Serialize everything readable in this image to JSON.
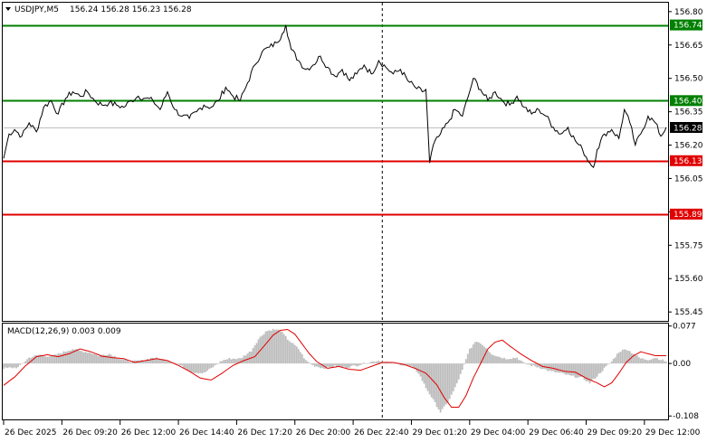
{
  "header": {
    "symbol": "USDJPY,M5",
    "ohlc": "156.24 156.28 156.23 156.28"
  },
  "chart_data": [
    {
      "type": "line",
      "title": "USDJPY,M5",
      "ylim": [
        155.41,
        156.84
      ],
      "y_ticks": [
        "156.80",
        "156.65",
        "156.50",
        "156.35",
        "156.20",
        "156.05",
        "155.90",
        "155.75",
        "155.60",
        "155.45"
      ],
      "y_tick_values": [
        156.8,
        156.65,
        156.5,
        156.35,
        156.2,
        156.05,
        155.9,
        155.75,
        155.6,
        155.45
      ],
      "x_labels": [
        "26 Dec 2025",
        "26 Dec 09:20",
        "26 Dec 12:00",
        "26 Dec 14:40",
        "26 Dec 17:20",
        "26 Dec 20:00",
        "26 Dec 22:40",
        "29 Dec 01:20",
        "29 Dec 04:00",
        "29 Dec 06:40",
        "29 Dec 09:20",
        "29 Dec 12:00"
      ],
      "x_label_index": [
        0,
        32,
        64,
        96,
        128,
        160,
        192,
        224,
        256,
        288,
        320,
        352
      ],
      "current_price": {
        "label": "156.28",
        "value": 156.28,
        "color": "#000000"
      },
      "levels": [
        {
          "label": "156.74",
          "value": 156.74,
          "color": "#008000"
        },
        {
          "label": "156.40",
          "value": 156.4,
          "color": "#008000"
        },
        {
          "label": "156.13",
          "value": 156.13,
          "color": "#e00000"
        },
        {
          "label": "155.89",
          "value": 155.89,
          "color": "#e00000"
        }
      ],
      "vline_index": 208,
      "series": [
        {
          "color": "#000000",
          "anchors": [
            [
              0,
              156.14
            ],
            [
              3,
              156.25
            ],
            [
              6,
              156.27
            ],
            [
              10,
              156.24
            ],
            [
              14,
              156.3
            ],
            [
              18,
              156.26
            ],
            [
              22,
              156.37
            ],
            [
              26,
              156.4
            ],
            [
              30,
              156.34
            ],
            [
              34,
              156.41
            ],
            [
              38,
              156.44
            ],
            [
              42,
              156.42
            ],
            [
              46,
              156.44
            ],
            [
              50,
              156.4
            ],
            [
              54,
              156.38
            ],
            [
              58,
              156.39
            ],
            [
              62,
              156.38
            ],
            [
              66,
              156.37
            ],
            [
              70,
              156.4
            ],
            [
              74,
              156.42
            ],
            [
              78,
              156.41
            ],
            [
              82,
              156.4
            ],
            [
              86,
              156.36
            ],
            [
              90,
              156.44
            ],
            [
              94,
              156.36
            ],
            [
              98,
              156.33
            ],
            [
              102,
              156.32
            ],
            [
              106,
              156.35
            ],
            [
              110,
              156.38
            ],
            [
              114,
              156.37
            ],
            [
              118,
              156.4
            ],
            [
              122,
              156.46
            ],
            [
              126,
              156.42
            ],
            [
              130,
              156.4
            ],
            [
              134,
              156.48
            ],
            [
              138,
              156.56
            ],
            [
              142,
              156.62
            ],
            [
              146,
              156.64
            ],
            [
              150,
              156.66
            ],
            [
              153,
              156.7
            ],
            [
              155,
              156.74
            ],
            [
              158,
              156.63
            ],
            [
              162,
              156.58
            ],
            [
              166,
              156.54
            ],
            [
              170,
              156.56
            ],
            [
              174,
              156.6
            ],
            [
              178,
              156.55
            ],
            [
              182,
              156.51
            ],
            [
              186,
              156.54
            ],
            [
              190,
              156.49
            ],
            [
              194,
              156.52
            ],
            [
              198,
              156.56
            ],
            [
              202,
              156.52
            ],
            [
              206,
              156.58
            ],
            [
              210,
              156.55
            ],
            [
              214,
              156.52
            ],
            [
              218,
              156.54
            ],
            [
              222,
              156.49
            ],
            [
              226,
              156.46
            ],
            [
              230,
              156.44
            ],
            [
              232,
              156.45
            ],
            [
              234,
              156.12
            ],
            [
              236,
              156.2
            ],
            [
              240,
              156.25
            ],
            [
              244,
              156.3
            ],
            [
              248,
              156.36
            ],
            [
              252,
              156.33
            ],
            [
              256,
              156.44
            ],
            [
              258,
              156.5
            ],
            [
              262,
              156.45
            ],
            [
              266,
              156.4
            ],
            [
              270,
              156.44
            ],
            [
              274,
              156.4
            ],
            [
              278,
              156.38
            ],
            [
              282,
              156.42
            ],
            [
              286,
              156.37
            ],
            [
              290,
              156.34
            ],
            [
              294,
              156.36
            ],
            [
              298,
              156.33
            ],
            [
              302,
              156.28
            ],
            [
              306,
              156.25
            ],
            [
              310,
              156.28
            ],
            [
              314,
              156.22
            ],
            [
              318,
              156.18
            ],
            [
              322,
              156.12
            ],
            [
              324,
              156.1
            ],
            [
              326,
              156.18
            ],
            [
              330,
              156.25
            ],
            [
              334,
              156.27
            ],
            [
              338,
              156.23
            ],
            [
              341,
              156.36
            ],
            [
              344,
              156.3
            ],
            [
              347,
              156.2
            ],
            [
              350,
              156.25
            ],
            [
              354,
              156.33
            ],
            [
              358,
              156.3
            ],
            [
              361,
              156.24
            ],
            [
              364,
              156.28
            ]
          ]
        }
      ]
    },
    {
      "type": "bar",
      "title": "MACD(12,26,9) 0.003 0.009",
      "ylim": [
        -0.115,
        0.082
      ],
      "y_ticks": [
        "0.077",
        "0.00",
        "-0.108"
      ],
      "y_tick_values": [
        0.077,
        0.0,
        -0.108
      ],
      "histogram_anchors": [
        [
          0,
          -0.01
        ],
        [
          8,
          -0.008
        ],
        [
          14,
          0.012
        ],
        [
          20,
          0.018
        ],
        [
          26,
          0.014
        ],
        [
          32,
          0.022
        ],
        [
          38,
          0.03
        ],
        [
          42,
          0.026
        ],
        [
          48,
          0.022
        ],
        [
          52,
          0.016
        ],
        [
          58,
          0.02
        ],
        [
          64,
          0.01
        ],
        [
          70,
          0.004
        ],
        [
          76,
          0.006
        ],
        [
          82,
          0.012
        ],
        [
          88,
          0.008
        ],
        [
          94,
          0.002
        ],
        [
          100,
          -0.01
        ],
        [
          104,
          -0.018
        ],
        [
          110,
          -0.02
        ],
        [
          114,
          -0.01
        ],
        [
          120,
          0.006
        ],
        [
          124,
          0.01
        ],
        [
          130,
          0.01
        ],
        [
          136,
          0.026
        ],
        [
          140,
          0.05
        ],
        [
          144,
          0.066
        ],
        [
          148,
          0.07
        ],
        [
          152,
          0.068
        ],
        [
          156,
          0.05
        ],
        [
          162,
          0.03
        ],
        [
          166,
          0.006
        ],
        [
          170,
          -0.004
        ],
        [
          176,
          -0.01
        ],
        [
          182,
          -0.006
        ],
        [
          188,
          -0.008
        ],
        [
          194,
          -0.004
        ],
        [
          200,
          0.002
        ],
        [
          206,
          0.006
        ],
        [
          212,
          0.002
        ],
        [
          218,
          -0.002
        ],
        [
          224,
          -0.006
        ],
        [
          228,
          -0.02
        ],
        [
          232,
          -0.05
        ],
        [
          236,
          -0.075
        ],
        [
          240,
          -0.1
        ],
        [
          244,
          -0.08
        ],
        [
          248,
          -0.05
        ],
        [
          252,
          -0.014
        ],
        [
          256,
          0.03
        ],
        [
          260,
          0.046
        ],
        [
          264,
          0.036
        ],
        [
          268,
          0.02
        ],
        [
          272,
          0.014
        ],
        [
          276,
          0.01
        ],
        [
          282,
          0.012
        ],
        [
          286,
          0.0
        ],
        [
          290,
          -0.004
        ],
        [
          296,
          -0.01
        ],
        [
          300,
          -0.016
        ],
        [
          306,
          -0.02
        ],
        [
          312,
          -0.026
        ],
        [
          318,
          -0.03
        ],
        [
          322,
          -0.04
        ],
        [
          326,
          -0.026
        ],
        [
          330,
          -0.01
        ],
        [
          334,
          0.004
        ],
        [
          338,
          0.024
        ],
        [
          342,
          0.03
        ],
        [
          346,
          0.02
        ],
        [
          350,
          0.01
        ],
        [
          354,
          0.008
        ],
        [
          358,
          0.012
        ],
        [
          364,
          0.004
        ]
      ],
      "signal": {
        "color": "#e00000",
        "anchors": [
          [
            0,
            -0.045
          ],
          [
            6,
            -0.028
          ],
          [
            12,
            -0.005
          ],
          [
            18,
            0.014
          ],
          [
            24,
            0.018
          ],
          [
            30,
            0.014
          ],
          [
            36,
            0.02
          ],
          [
            42,
            0.03
          ],
          [
            48,
            0.024
          ],
          [
            54,
            0.015
          ],
          [
            60,
            0.012
          ],
          [
            66,
            0.01
          ],
          [
            72,
            0.002
          ],
          [
            78,
            0.006
          ],
          [
            84,
            0.01
          ],
          [
            90,
            0.006
          ],
          [
            96,
            -0.004
          ],
          [
            102,
            -0.016
          ],
          [
            108,
            -0.03
          ],
          [
            114,
            -0.034
          ],
          [
            120,
            -0.02
          ],
          [
            126,
            -0.004
          ],
          [
            132,
            0.006
          ],
          [
            138,
            0.014
          ],
          [
            144,
            0.04
          ],
          [
            148,
            0.058
          ],
          [
            152,
            0.068
          ],
          [
            156,
            0.07
          ],
          [
            160,
            0.06
          ],
          [
            164,
            0.04
          ],
          [
            168,
            0.02
          ],
          [
            172,
            0.004
          ],
          [
            178,
            -0.01
          ],
          [
            184,
            -0.006
          ],
          [
            190,
            -0.012
          ],
          [
            196,
            -0.014
          ],
          [
            202,
            -0.006
          ],
          [
            208,
            0.002
          ],
          [
            214,
            0.002
          ],
          [
            220,
            -0.002
          ],
          [
            226,
            -0.01
          ],
          [
            232,
            -0.02
          ],
          [
            238,
            -0.044
          ],
          [
            242,
            -0.07
          ],
          [
            246,
            -0.09
          ],
          [
            250,
            -0.09
          ],
          [
            254,
            -0.066
          ],
          [
            258,
            -0.03
          ],
          [
            262,
            0.0
          ],
          [
            266,
            0.03
          ],
          [
            270,
            0.044
          ],
          [
            274,
            0.048
          ],
          [
            278,
            0.036
          ],
          [
            284,
            0.02
          ],
          [
            290,
            0.006
          ],
          [
            296,
            -0.006
          ],
          [
            302,
            -0.01
          ],
          [
            308,
            -0.016
          ],
          [
            314,
            -0.018
          ],
          [
            320,
            -0.03
          ],
          [
            326,
            -0.04
          ],
          [
            330,
            -0.048
          ],
          [
            334,
            -0.04
          ],
          [
            338,
            -0.02
          ],
          [
            342,
            0.002
          ],
          [
            346,
            0.016
          ],
          [
            350,
            0.024
          ],
          [
            354,
            0.02
          ],
          [
            358,
            0.016
          ],
          [
            364,
            0.016
          ]
        ]
      }
    }
  ]
}
